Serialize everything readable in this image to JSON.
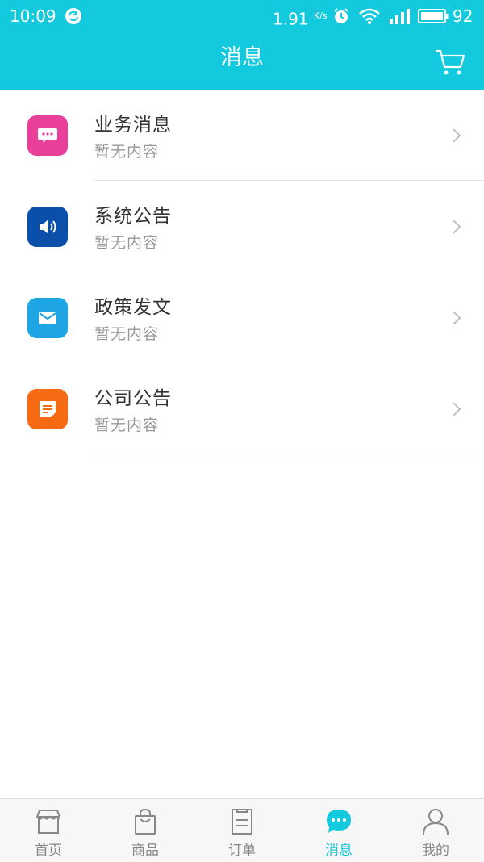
{
  "status_bar": {
    "time": "10:09",
    "speed": "1.91",
    "speed_unit": "K/s",
    "battery": "92"
  },
  "header": {
    "title": "消息",
    "cart_icon": "cart-icon"
  },
  "messages": [
    {
      "label": "业务消息",
      "subtitle": "暂无内容",
      "icon": "chat-bubble-icon",
      "color": "#e8409a"
    },
    {
      "label": "系统公告",
      "subtitle": "暂无内容",
      "icon": "speaker-icon",
      "color": "#0a4faa"
    },
    {
      "label": "政策发文",
      "subtitle": "暂无内容",
      "icon": "envelope-icon",
      "color": "#1ea5e3"
    },
    {
      "label": "公司公告",
      "subtitle": "暂无内容",
      "icon": "note-icon",
      "color": "#f76a14"
    }
  ],
  "bottom_nav": [
    {
      "label": "首页",
      "icon": "storefront-icon",
      "active": false
    },
    {
      "label": "商品",
      "icon": "shopping-bag-icon",
      "active": false
    },
    {
      "label": "订单",
      "icon": "order-list-icon",
      "active": false
    },
    {
      "label": "消息",
      "icon": "message-bubble-icon",
      "active": true
    },
    {
      "label": "我的",
      "icon": "person-icon",
      "active": false
    }
  ],
  "colors": {
    "accent": "#12c9de",
    "inactive": "#888888",
    "divider": "#e2e2e2"
  }
}
